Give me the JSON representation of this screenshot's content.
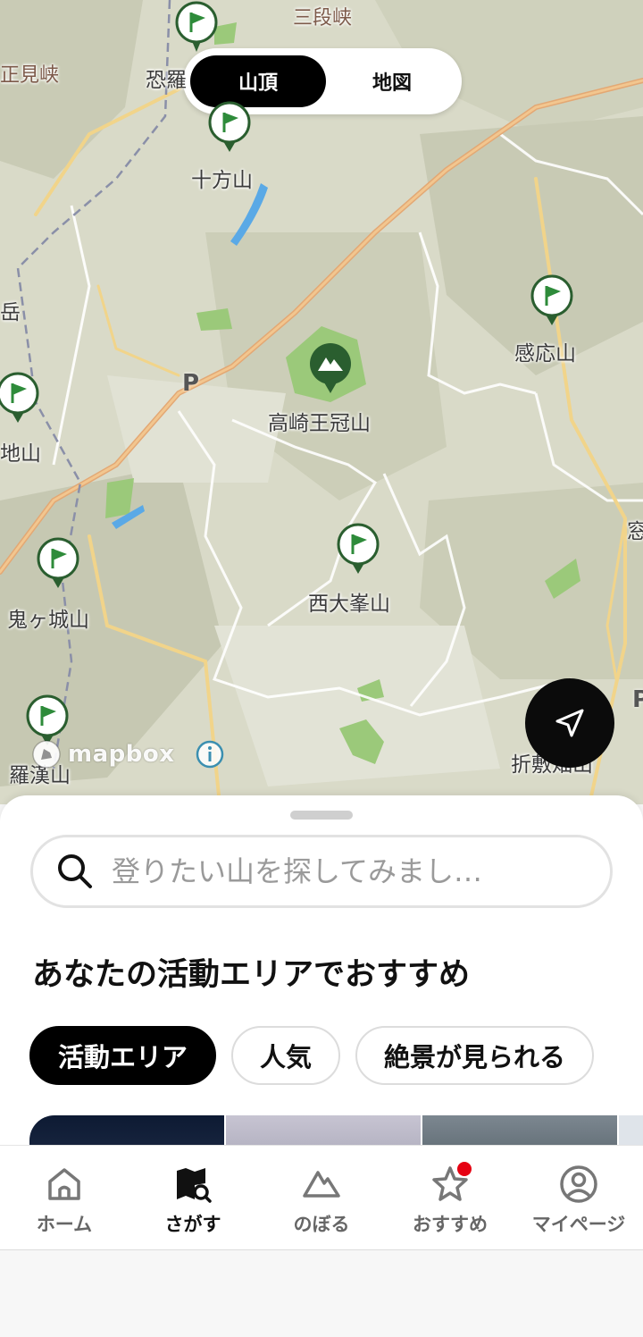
{
  "segmented_control": {
    "options": [
      "山頂",
      "地図"
    ],
    "selected": "山頂"
  },
  "map": {
    "peaks": [
      {
        "name": "十方山",
        "type": "flag"
      },
      {
        "name": "感応山",
        "type": "flag"
      },
      {
        "name": "高崎王冠山",
        "type": "mountain"
      },
      {
        "name": "西大峯山",
        "type": "flag"
      },
      {
        "name": "鬼ヶ城山",
        "type": "flag"
      },
      {
        "name": "羅漢山",
        "type": "flag"
      },
      {
        "name": "恐羅",
        "type": "flag"
      },
      {
        "name": "地山",
        "type": "flag"
      }
    ],
    "place_labels": [
      "三段峡",
      "正見峡",
      "岳",
      "折敷畑山",
      "窓"
    ],
    "parking_label": "P",
    "attribution": "mapbox"
  },
  "search": {
    "placeholder": "登りたい山を探してみまし…",
    "value": ""
  },
  "recommend": {
    "title": "あなたの活動エリアでおすすめ",
    "chips": [
      "活動エリア",
      "人気",
      "絶景が見られる"
    ],
    "selected_chip": "活動エリア"
  },
  "tabbar": {
    "items": [
      {
        "label": "ホーム",
        "icon": "home-icon"
      },
      {
        "label": "さがす",
        "icon": "map-search-icon"
      },
      {
        "label": "のぼる",
        "icon": "mountain-icon"
      },
      {
        "label": "おすすめ",
        "icon": "star-icon"
      },
      {
        "label": "マイページ",
        "icon": "user-icon"
      }
    ],
    "active": "さがす",
    "badge_on": "おすすめ"
  },
  "colors": {
    "accent": "#000000",
    "pin_green": "#2e8b3a",
    "badge": "#e60012"
  }
}
